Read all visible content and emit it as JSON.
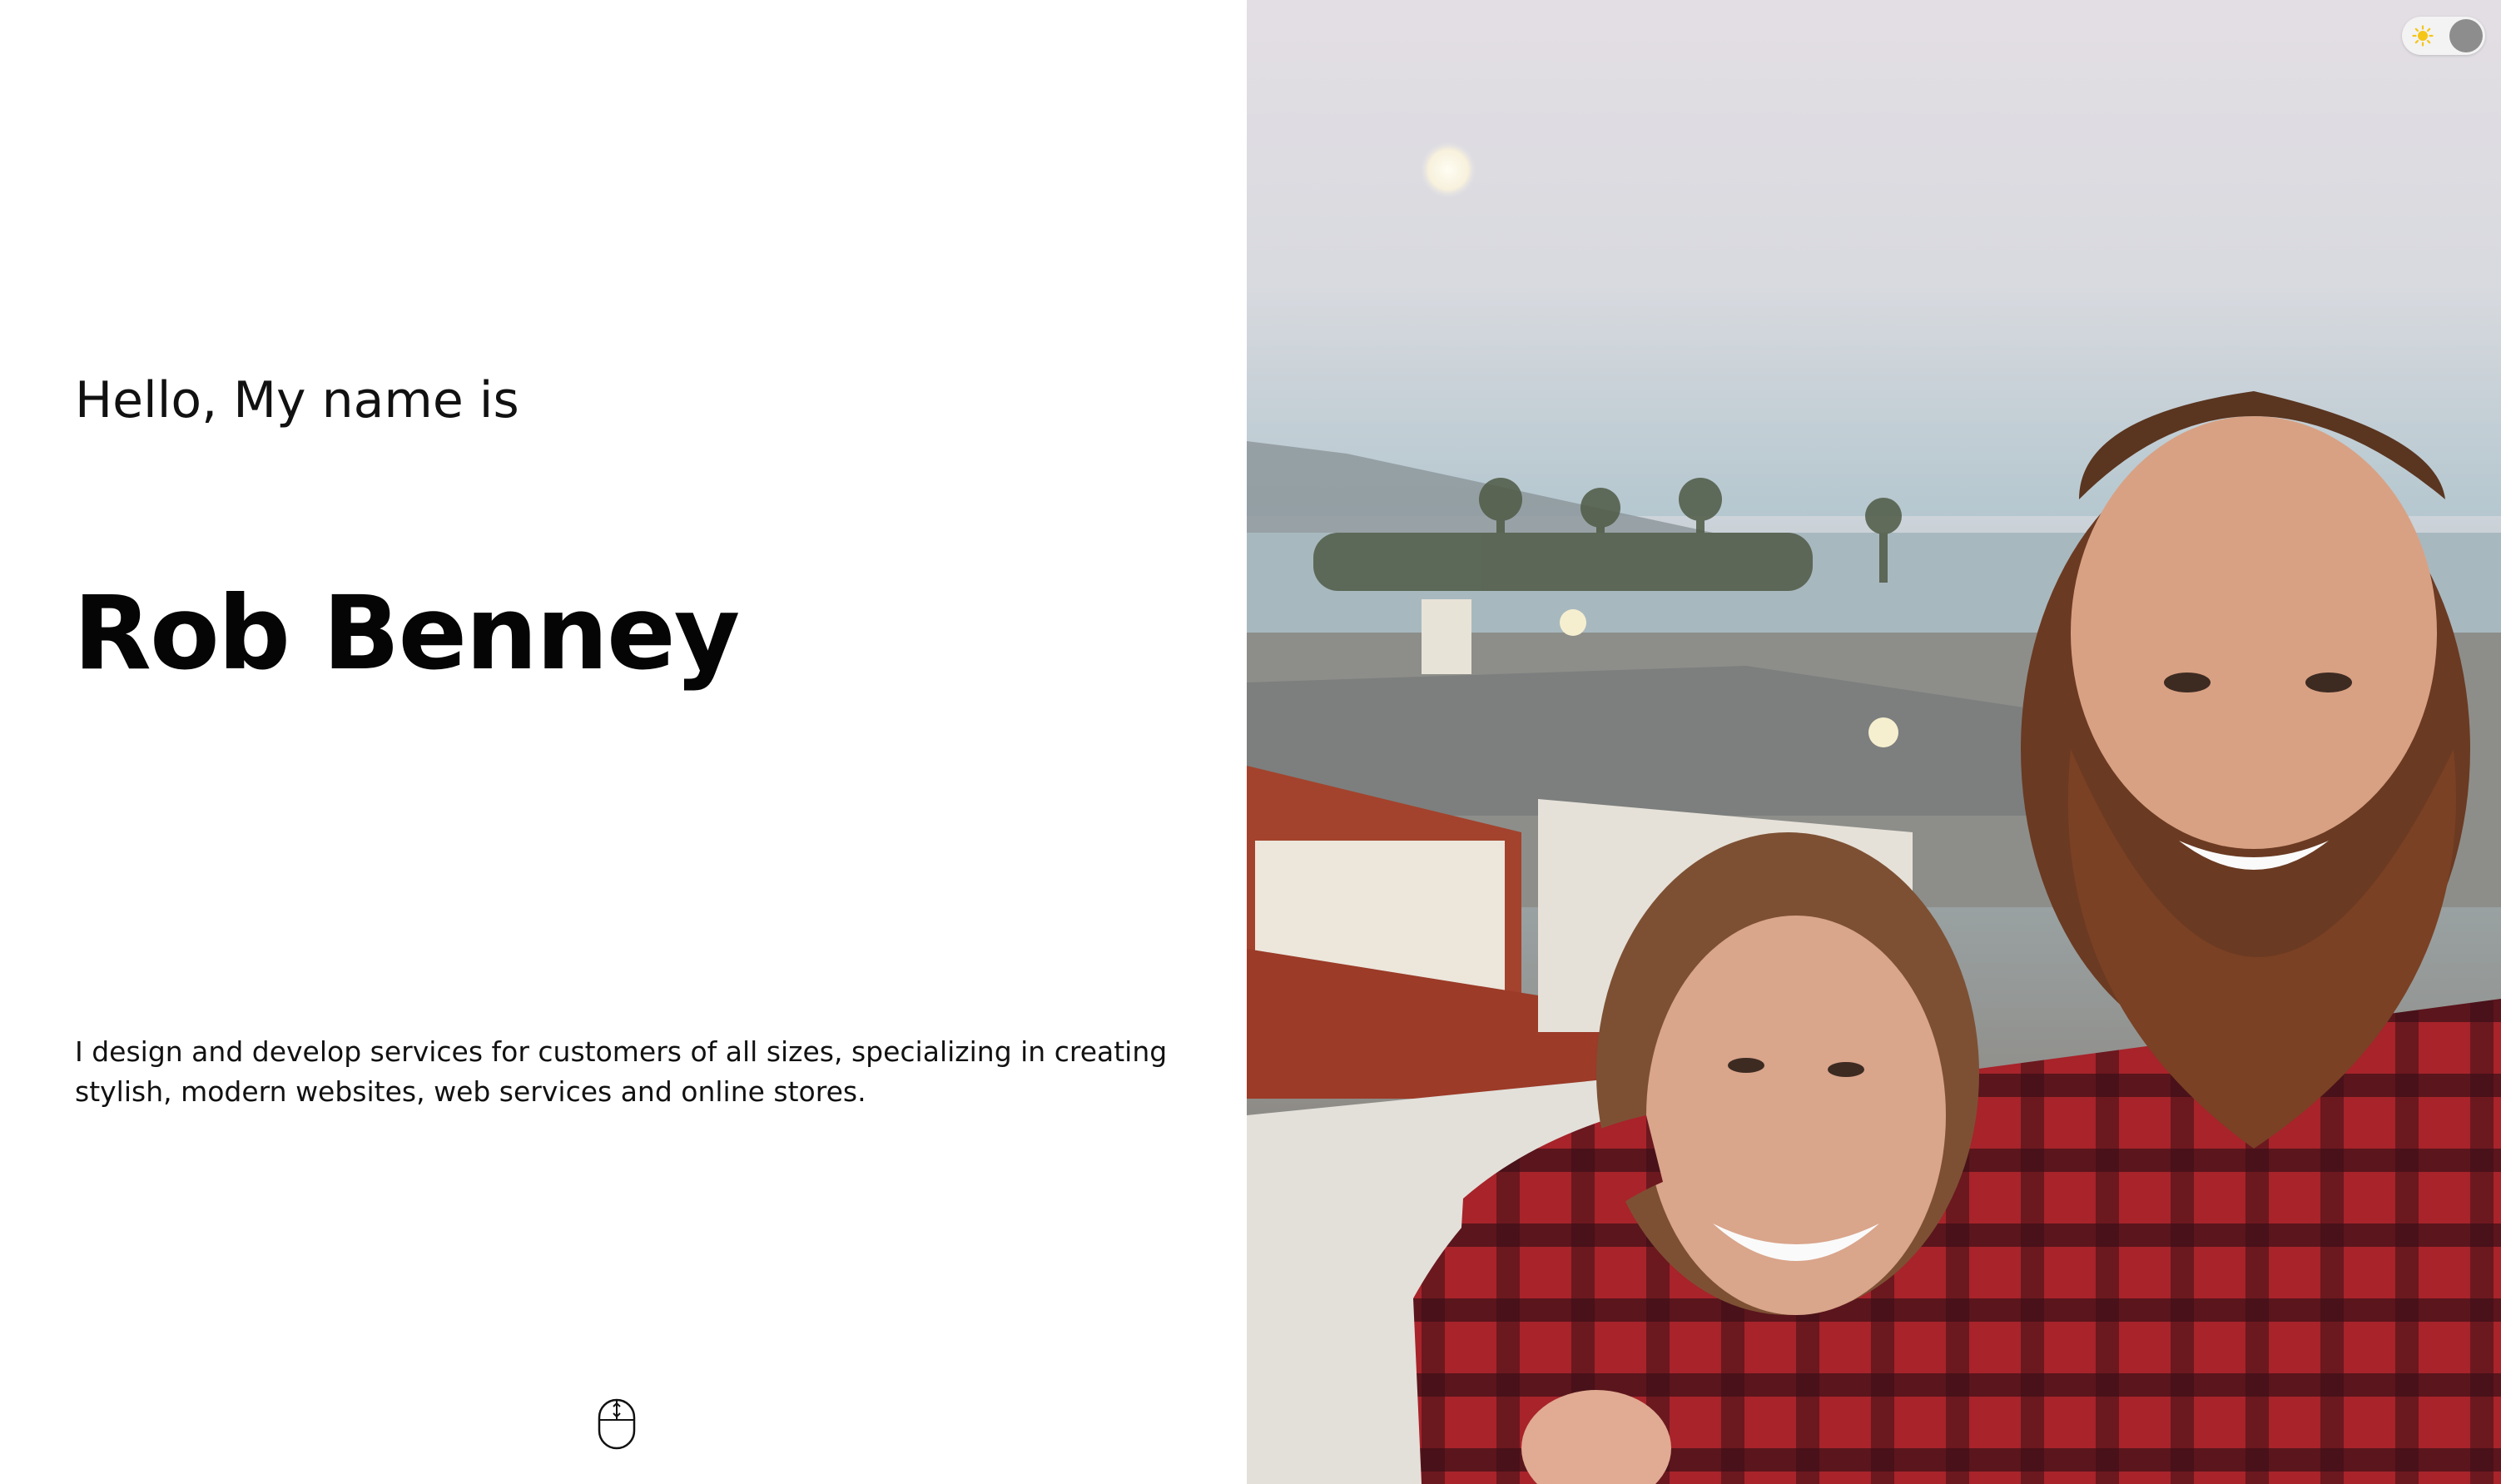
{
  "hero": {
    "greeting": "Hello, My name is",
    "name": "Rob Benney",
    "bio": "I design and develop services for customers of all sizes, specializing in creating stylish, modern websites, web services and online stores."
  },
  "icons": {
    "scroll": "mouse-scroll-icon",
    "theme_light": "sun-icon"
  },
  "colors": {
    "text": "#111111",
    "background": "#ffffff",
    "toggle_knob": "#8d8d8d",
    "sun": "#f5c518"
  }
}
